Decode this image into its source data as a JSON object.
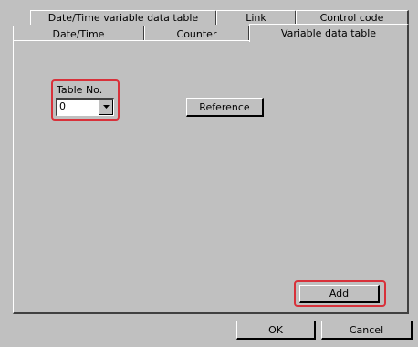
{
  "tabs_back_row": [
    {
      "label": "Date/Time variable data table"
    },
    {
      "label": "Link"
    },
    {
      "label": "Control code"
    }
  ],
  "tabs_front_row": [
    {
      "label": "Date/Time"
    },
    {
      "label": "Counter"
    },
    {
      "label": "Variable data table",
      "selected": true
    }
  ],
  "table_no": {
    "label": "Table No.",
    "value": "0"
  },
  "buttons": {
    "reference": "Reference",
    "add": "Add",
    "ok": "OK",
    "cancel": "Cancel"
  },
  "colors": {
    "highlight": "#d8313a",
    "face": "#c0c0c0"
  },
  "icons": {
    "combo_arrow": "chevron-down-icon"
  }
}
